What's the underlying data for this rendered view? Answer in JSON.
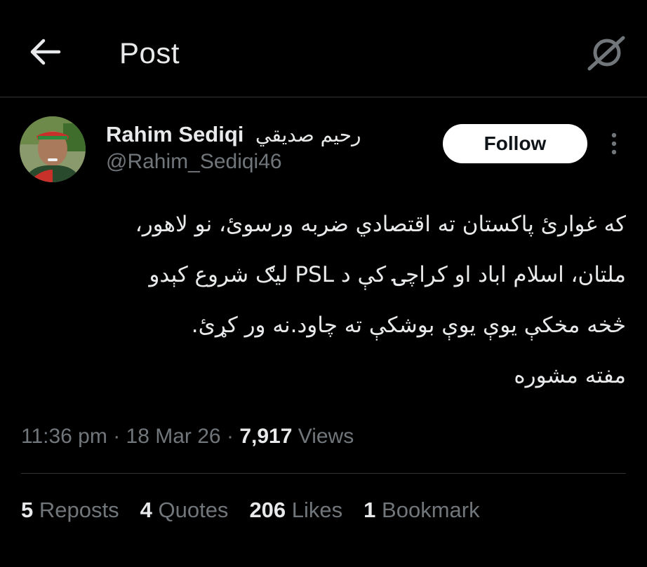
{
  "header": {
    "title": "Post"
  },
  "author": {
    "display_name": "Rahim Sediqi",
    "display_name_native": "رحیم صدیقي",
    "handle": "@Rahim_Sediqi46",
    "follow_label": "Follow"
  },
  "tweet": {
    "lines": [
      "که غوارئ پاکستان ته اقتصادي ضربه ورسوئ، نو لاهور،",
      "ملتان، اسلام اباد او کراچۍ کې د PSL لیګ شروع کېدو",
      "څخه مخکې یوې یوې بوشکې ته چاود.نه ور کړئ.",
      "مفته مشوره"
    ]
  },
  "meta": {
    "time": "11:36 pm",
    "sep1": "·",
    "date": "18 Mar 26",
    "sep2": "·",
    "views_count": "7,917",
    "views_label": "Views"
  },
  "stats": {
    "reposts_count": "5",
    "reposts_label": "Reposts",
    "quotes_count": "4",
    "quotes_label": "Quotes",
    "likes_count": "206",
    "likes_label": "Likes",
    "bookmarks_count": "1",
    "bookmarks_label": "Bookmark"
  },
  "icons": {
    "back": "arrow-left-icon",
    "grok": "grok-icon",
    "more": "more-vertical-icon"
  }
}
